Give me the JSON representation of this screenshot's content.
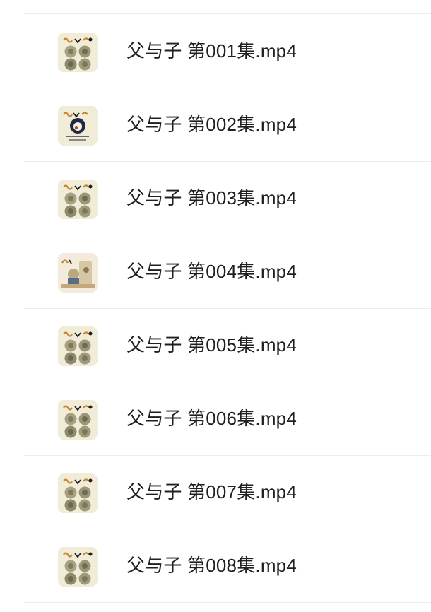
{
  "files": [
    {
      "name": "父与子 第001集.mp4",
      "thumbnail": "comic-grid-icon"
    },
    {
      "name": "父与子 第002集.mp4",
      "thumbnail": "comic-cover-badge-icon"
    },
    {
      "name": "父与子 第003集.mp4",
      "thumbnail": "comic-grid-icon"
    },
    {
      "name": "父与子 第004集.mp4",
      "thumbnail": "comic-scene-icon"
    },
    {
      "name": "父与子 第005集.mp4",
      "thumbnail": "comic-grid-icon"
    },
    {
      "name": "父与子 第006集.mp4",
      "thumbnail": "comic-grid-icon"
    },
    {
      "name": "父与子 第007集.mp4",
      "thumbnail": "comic-grid-icon"
    },
    {
      "name": "父与子 第008集.mp4",
      "thumbnail": "comic-grid-icon"
    }
  ],
  "colors": {
    "text": "#1f1f1f",
    "divider": "#ececec",
    "thumbnail_bg": "#f1ecd8"
  }
}
